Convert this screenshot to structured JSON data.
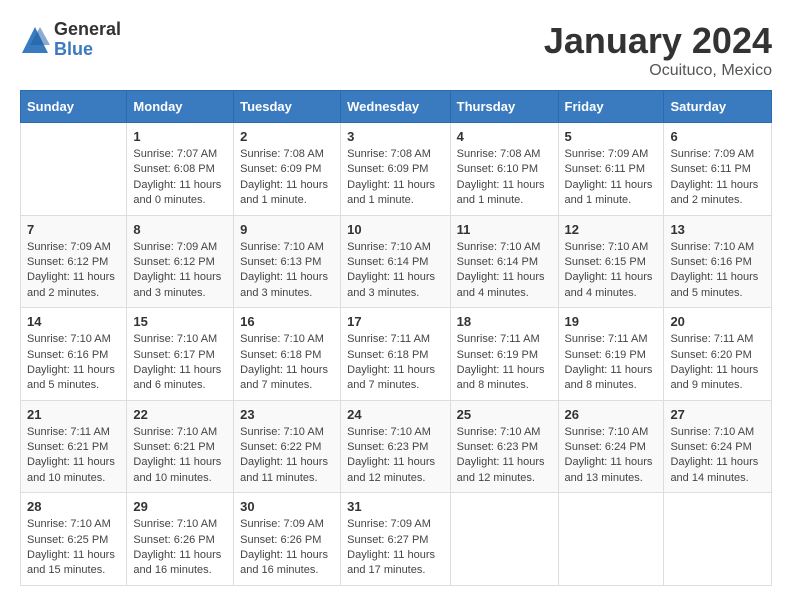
{
  "logo": {
    "general": "General",
    "blue": "Blue"
  },
  "title": "January 2024",
  "location": "Ocuituco, Mexico",
  "days_header": [
    "Sunday",
    "Monday",
    "Tuesday",
    "Wednesday",
    "Thursday",
    "Friday",
    "Saturday"
  ],
  "weeks": [
    [
      {
        "day": "",
        "info": ""
      },
      {
        "day": "1",
        "info": "Sunrise: 7:07 AM\nSunset: 6:08 PM\nDaylight: 11 hours and 0 minutes."
      },
      {
        "day": "2",
        "info": "Sunrise: 7:08 AM\nSunset: 6:09 PM\nDaylight: 11 hours and 1 minute."
      },
      {
        "day": "3",
        "info": "Sunrise: 7:08 AM\nSunset: 6:09 PM\nDaylight: 11 hours and 1 minute."
      },
      {
        "day": "4",
        "info": "Sunrise: 7:08 AM\nSunset: 6:10 PM\nDaylight: 11 hours and 1 minute."
      },
      {
        "day": "5",
        "info": "Sunrise: 7:09 AM\nSunset: 6:11 PM\nDaylight: 11 hours and 1 minute."
      },
      {
        "day": "6",
        "info": "Sunrise: 7:09 AM\nSunset: 6:11 PM\nDaylight: 11 hours and 2 minutes."
      }
    ],
    [
      {
        "day": "7",
        "info": "Sunrise: 7:09 AM\nSunset: 6:12 PM\nDaylight: 11 hours and 2 minutes."
      },
      {
        "day": "8",
        "info": "Sunrise: 7:09 AM\nSunset: 6:12 PM\nDaylight: 11 hours and 3 minutes."
      },
      {
        "day": "9",
        "info": "Sunrise: 7:10 AM\nSunset: 6:13 PM\nDaylight: 11 hours and 3 minutes."
      },
      {
        "day": "10",
        "info": "Sunrise: 7:10 AM\nSunset: 6:14 PM\nDaylight: 11 hours and 3 minutes."
      },
      {
        "day": "11",
        "info": "Sunrise: 7:10 AM\nSunset: 6:14 PM\nDaylight: 11 hours and 4 minutes."
      },
      {
        "day": "12",
        "info": "Sunrise: 7:10 AM\nSunset: 6:15 PM\nDaylight: 11 hours and 4 minutes."
      },
      {
        "day": "13",
        "info": "Sunrise: 7:10 AM\nSunset: 6:16 PM\nDaylight: 11 hours and 5 minutes."
      }
    ],
    [
      {
        "day": "14",
        "info": "Sunrise: 7:10 AM\nSunset: 6:16 PM\nDaylight: 11 hours and 5 minutes."
      },
      {
        "day": "15",
        "info": "Sunrise: 7:10 AM\nSunset: 6:17 PM\nDaylight: 11 hours and 6 minutes."
      },
      {
        "day": "16",
        "info": "Sunrise: 7:10 AM\nSunset: 6:18 PM\nDaylight: 11 hours and 7 minutes."
      },
      {
        "day": "17",
        "info": "Sunrise: 7:11 AM\nSunset: 6:18 PM\nDaylight: 11 hours and 7 minutes."
      },
      {
        "day": "18",
        "info": "Sunrise: 7:11 AM\nSunset: 6:19 PM\nDaylight: 11 hours and 8 minutes."
      },
      {
        "day": "19",
        "info": "Sunrise: 7:11 AM\nSunset: 6:19 PM\nDaylight: 11 hours and 8 minutes."
      },
      {
        "day": "20",
        "info": "Sunrise: 7:11 AM\nSunset: 6:20 PM\nDaylight: 11 hours and 9 minutes."
      }
    ],
    [
      {
        "day": "21",
        "info": "Sunrise: 7:11 AM\nSunset: 6:21 PM\nDaylight: 11 hours and 10 minutes."
      },
      {
        "day": "22",
        "info": "Sunrise: 7:10 AM\nSunset: 6:21 PM\nDaylight: 11 hours and 10 minutes."
      },
      {
        "day": "23",
        "info": "Sunrise: 7:10 AM\nSunset: 6:22 PM\nDaylight: 11 hours and 11 minutes."
      },
      {
        "day": "24",
        "info": "Sunrise: 7:10 AM\nSunset: 6:23 PM\nDaylight: 11 hours and 12 minutes."
      },
      {
        "day": "25",
        "info": "Sunrise: 7:10 AM\nSunset: 6:23 PM\nDaylight: 11 hours and 12 minutes."
      },
      {
        "day": "26",
        "info": "Sunrise: 7:10 AM\nSunset: 6:24 PM\nDaylight: 11 hours and 13 minutes."
      },
      {
        "day": "27",
        "info": "Sunrise: 7:10 AM\nSunset: 6:24 PM\nDaylight: 11 hours and 14 minutes."
      }
    ],
    [
      {
        "day": "28",
        "info": "Sunrise: 7:10 AM\nSunset: 6:25 PM\nDaylight: 11 hours and 15 minutes."
      },
      {
        "day": "29",
        "info": "Sunrise: 7:10 AM\nSunset: 6:26 PM\nDaylight: 11 hours and 16 minutes."
      },
      {
        "day": "30",
        "info": "Sunrise: 7:09 AM\nSunset: 6:26 PM\nDaylight: 11 hours and 16 minutes."
      },
      {
        "day": "31",
        "info": "Sunrise: 7:09 AM\nSunset: 6:27 PM\nDaylight: 11 hours and 17 minutes."
      },
      {
        "day": "",
        "info": ""
      },
      {
        "day": "",
        "info": ""
      },
      {
        "day": "",
        "info": ""
      }
    ]
  ]
}
